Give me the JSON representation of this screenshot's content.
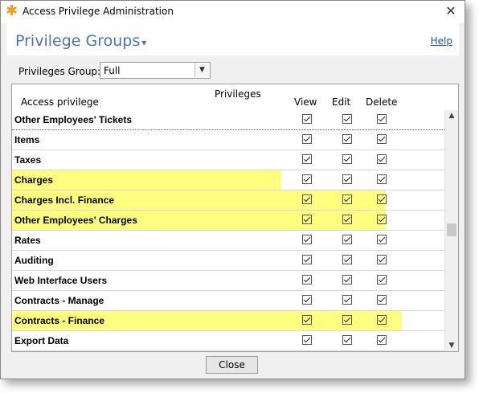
{
  "window": {
    "title": "Access Privilege Administration",
    "close_glyph": "✕"
  },
  "header": {
    "title": "Privilege Groups",
    "caret": "▾",
    "help": "Help"
  },
  "group_select": {
    "label": "Privileges Group:",
    "value": "Full"
  },
  "table": {
    "headers": {
      "access": "Access privilege",
      "privileges": "Privileges",
      "view": "View",
      "edit": "Edit",
      "delete": "Delete"
    },
    "highlight_color": "#ffff80",
    "rows": [
      {
        "label": "Other Employees' Tickets",
        "view": true,
        "edit": true,
        "delete": true,
        "highlighted": false
      },
      {
        "label": "Items",
        "view": true,
        "edit": true,
        "delete": true,
        "highlighted": false
      },
      {
        "label": "Taxes",
        "view": true,
        "edit": true,
        "delete": true,
        "highlighted": false
      },
      {
        "label": "Charges",
        "view": true,
        "edit": true,
        "delete": true,
        "highlighted": true
      },
      {
        "label": "Charges Incl. Finance",
        "view": true,
        "edit": true,
        "delete": true,
        "highlighted": true
      },
      {
        "label": "Other Employees' Charges",
        "view": true,
        "edit": true,
        "delete": true,
        "highlighted": true
      },
      {
        "label": "Rates",
        "view": true,
        "edit": true,
        "delete": true,
        "highlighted": false
      },
      {
        "label": "Auditing",
        "view": true,
        "edit": true,
        "delete": true,
        "highlighted": false
      },
      {
        "label": "Web Interface Users",
        "view": true,
        "edit": true,
        "delete": true,
        "highlighted": false
      },
      {
        "label": "Contracts - Manage",
        "view": true,
        "edit": true,
        "delete": true,
        "highlighted": false
      },
      {
        "label": "Contracts - Finance",
        "view": true,
        "edit": true,
        "delete": true,
        "highlighted": true
      },
      {
        "label": "Export Data",
        "view": true,
        "edit": true,
        "delete": true,
        "highlighted": false
      }
    ]
  },
  "footer": {
    "close": "Close"
  },
  "icons": {
    "app": "orange-asterisk-icon",
    "dropdown": "chevron-down-icon",
    "scroll_up": "arrow-up-icon",
    "scroll_down": "arrow-down-icon"
  }
}
